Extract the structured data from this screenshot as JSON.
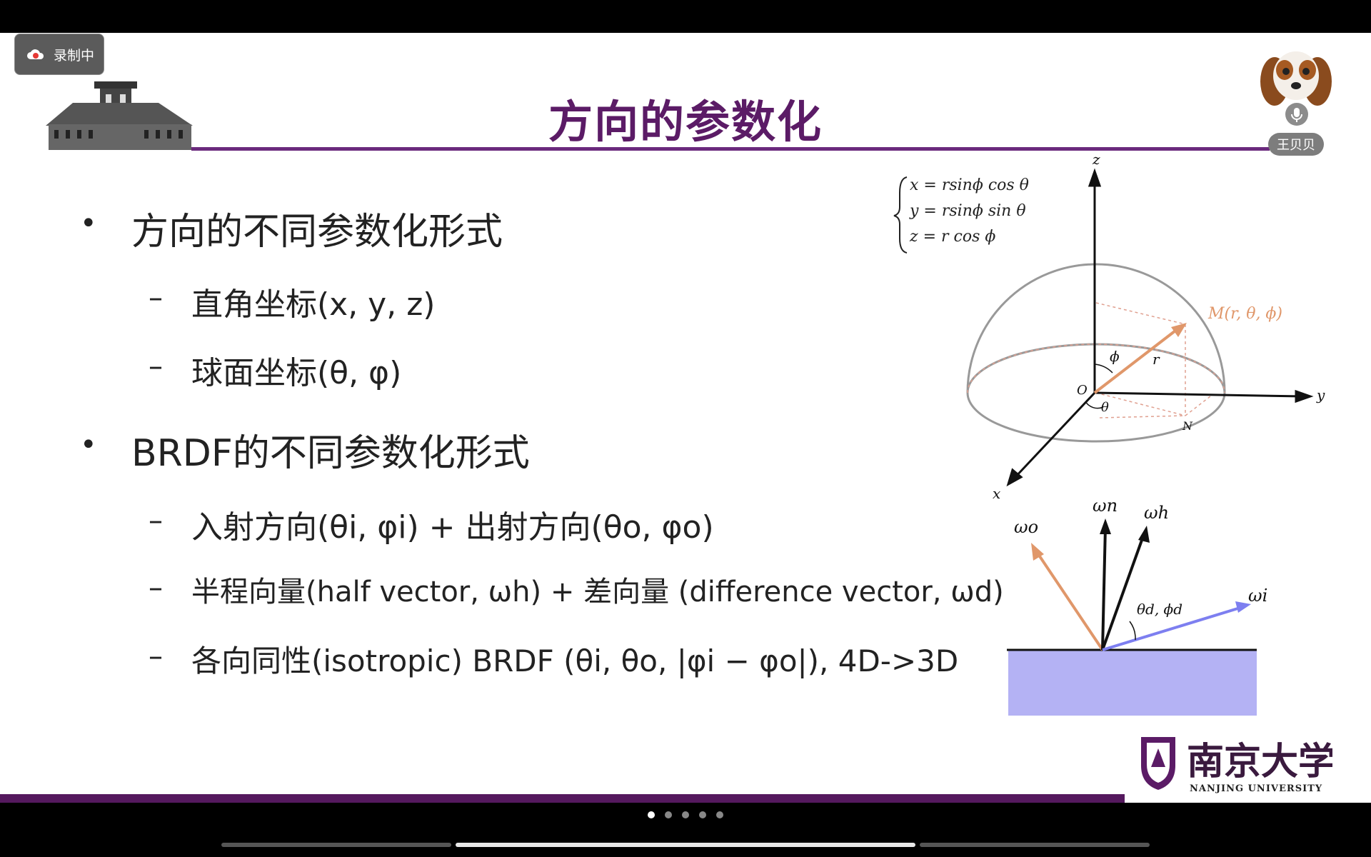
{
  "recording": {
    "label": "录制中"
  },
  "slide": {
    "title": "方向的参数化",
    "bullets": [
      {
        "text": "方向的不同参数化形式"
      },
      {
        "text": "BRDF的不同参数化形式"
      }
    ],
    "sub_items": [
      {
        "text": "直角坐标(x, y, z)"
      },
      {
        "text": "球面坐标(θ, φ)"
      },
      {
        "text": "入射方向(θi, φi) + 出射方向(θo, φo)"
      },
      {
        "text": "半程向量(half vector, ωh) + 差向量 (difference vector, ωd)"
      },
      {
        "text": "各向同性(isotropic) BRDF (θi, θo, |φi  − φo|), 4D->3D"
      }
    ]
  },
  "equations": [
    "x = rsinϕ cos θ",
    "y = rsinϕ sin θ",
    "z = r cos ϕ"
  ],
  "diagram_labels": {
    "z": "z",
    "y": "y",
    "x": "x",
    "O": "O",
    "M": "M(r, θ, ϕ)",
    "r": "r",
    "phi": "ϕ",
    "theta": "θ",
    "N": "N",
    "wo": "ωo",
    "wn": "ωn",
    "wh": "ωh",
    "wi": "ωi",
    "td": "θd, ϕd"
  },
  "participant": {
    "name": "王贝贝"
  },
  "university": {
    "cn": "南京大学",
    "en": "NANJING UNIVERSITY"
  },
  "pager": {
    "total": 5,
    "active": 1
  },
  "colors": {
    "title": "#5b1b66",
    "accent_orange": "#e0976a",
    "accent_blue": "#7d7ff0",
    "surface": "#b4b2f4"
  }
}
